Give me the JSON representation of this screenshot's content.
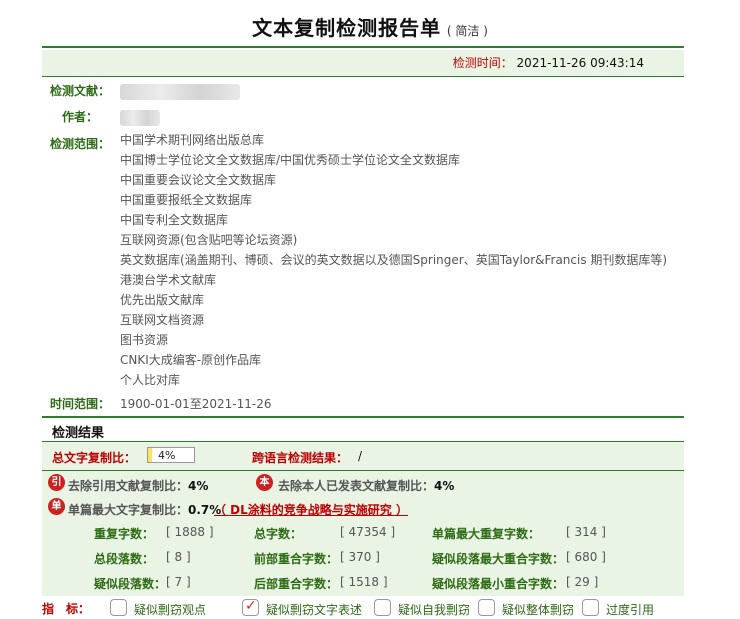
{
  "header": {
    "title": "文本复制检测报告单",
    "subtitle": "( 简洁 )",
    "time_label": "检测时间：",
    "time_value": "2021-11-26 09:43:14"
  },
  "info": {
    "doc_label": "检测文献：",
    "author_label": "作者：",
    "scope_label": "检测范围：",
    "scope_items": [
      "中国学术期刊网络出版总库",
      "中国博士学位论文全文数据库/中国优秀硕士学位论文全文数据库",
      "中国重要会议论文全文数据库",
      "中国重要报纸全文数据库",
      "中国专利全文数据库",
      "互联网资源(包含贴吧等论坛资源)",
      "英文数据库(涵盖期刊、博硕、会议的英文数据以及德国Springer、英国Taylor&Francis 期刊数据库等)",
      "港澳台学术文献库",
      "优先出版文献库",
      "互联网文档资源",
      "图书资源",
      "CNKI大成编客-原创作品库",
      "个人比对库"
    ],
    "time_range_label": "时间范围：",
    "time_range_value": "1900-01-01至2021-11-26"
  },
  "results": {
    "title": "检测结果",
    "total_label": "总文字复制比：",
    "total_value": "4%",
    "total_fraction": 0.04,
    "cross_label": "跨语言检测结果：",
    "cross_value": "/",
    "badge_yin": "引",
    "excl_cite_label": "去除引用文献复制比：",
    "excl_cite_value": "4%",
    "badge_ben": "本",
    "excl_self_label": "去除本人已发表文献复制比：",
    "excl_self_value": "4%",
    "badge_dan": "单",
    "single_max_label": "单篇最大文字复制比：",
    "single_max_value": "0.7%",
    "single_max_link": "（ DL涂料的竞争战略与实施研究 ）",
    "stats": [
      {
        "label": "重复字数：",
        "value": "[ 1888 ]"
      },
      {
        "label": "总字数：",
        "value": "[ 47354 ]"
      },
      {
        "label": "单篇最大重复字数：",
        "value": "[ 314 ]"
      },
      {
        "label": "总段落数：",
        "value": "[ 8 ]"
      },
      {
        "label": "前部重合字数：",
        "value": "[ 370 ]"
      },
      {
        "label": "疑似段落最大重合字数：",
        "value": "[ 680 ]"
      },
      {
        "label": "疑似段落数：",
        "value": "[ 7 ]"
      },
      {
        "label": "后部重合字数：",
        "value": "[ 1518 ]"
      },
      {
        "label": "疑似段落最小重合字数：",
        "value": "[ 29 ]"
      }
    ]
  },
  "indicator": {
    "label": "指　标：",
    "options": [
      {
        "label": "疑似剽窃观点",
        "checked": false
      },
      {
        "label": "疑似剽窃文字表述",
        "checked": true
      },
      {
        "label": "疑似自我剽窃",
        "checked": false
      },
      {
        "label": "疑似整体剽窃",
        "checked": false
      },
      {
        "label": "过度引用",
        "checked": false
      }
    ],
    "check_mark": "✓"
  },
  "colors": {
    "accent_green": "#2d7d2d",
    "label_green": "#2d6b14",
    "alert_red": "#c00000",
    "panel_bg": "#eaf4e4"
  }
}
